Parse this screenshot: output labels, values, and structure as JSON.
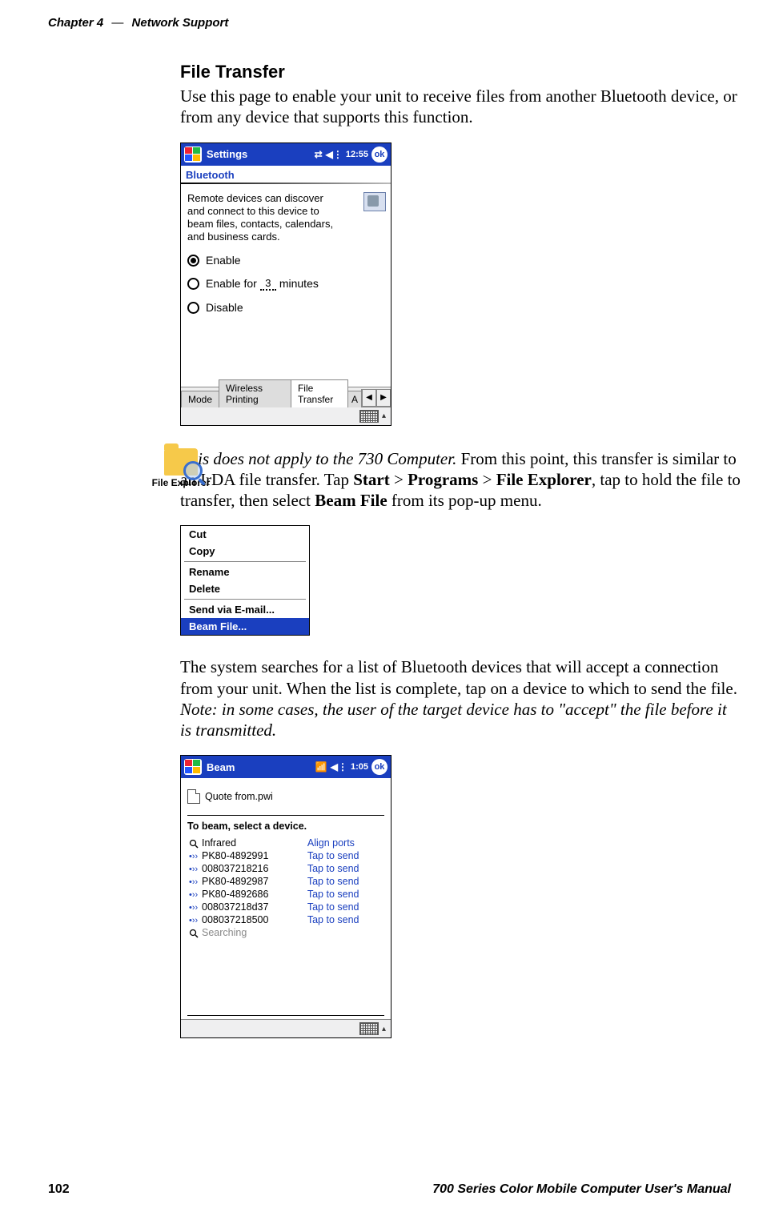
{
  "header": {
    "chapter": "Chapter 4",
    "dash": "—",
    "section": "Network Support"
  },
  "h2": "File Transfer",
  "p1": "Use this page to enable your unit to receive files from another Bluetooth device, or from any device that supports this function.",
  "settings": {
    "title": "Settings",
    "time": "12:55",
    "ok": "ok",
    "heading": "Bluetooth",
    "desc": "Remote devices can discover and connect to this device to beam files, contacts, calendars, and business cards.",
    "opt_enable": "Enable",
    "opt_enable_for_pre": "Enable for",
    "opt_enable_for_value": "3",
    "opt_enable_for_post": "minutes",
    "opt_disable": "Disable",
    "tabs": {
      "mode": "Mode",
      "wp": "Wireless Printing",
      "ft": "File Transfer",
      "extra": "A"
    }
  },
  "fe_label": "File Explorer",
  "p2_italic": "This does not apply to the 730 Computer.",
  "p2_a": " From this point, this transfer is similar to an IrDA file transfer. Tap ",
  "p2_start": "Start",
  "p2_gt1": " > ",
  "p2_programs": "Programs",
  "p2_gt2": " > ",
  "p2_fe": "File Explorer",
  "p2_b": ", tap to hold the file to transfer, then select ",
  "p2_beam": "Beam File",
  "p2_c": " from its pop-up menu.",
  "ctx": {
    "cut": "Cut",
    "copy": "Copy",
    "rename": "Rename",
    "delete": "Delete",
    "email": "Send via E-mail...",
    "beam": "Beam File..."
  },
  "p3_a": "The system searches for a list of Bluetooth devices that will accept a connection from your unit. When the list is complete, tap on a device to which to send the file. ",
  "p3_note": "Note: in some cases, the user of the target device has to \"accept\" the file before it is transmitted.",
  "beam": {
    "title": "Beam",
    "time": "1:05",
    "ok": "ok",
    "file": "Quote from.pwi",
    "instr": "To beam, select a device.",
    "rows": [
      {
        "icon": "ir",
        "name": "Infrared",
        "action": "Align ports"
      },
      {
        "icon": "bt",
        "name": "PK80-4892991",
        "action": "Tap to send"
      },
      {
        "icon": "bt",
        "name": "008037218216",
        "action": "Tap to send"
      },
      {
        "icon": "bt",
        "name": "PK80-4892987",
        "action": "Tap to send"
      },
      {
        "icon": "bt",
        "name": "PK80-4892686",
        "action": "Tap to send"
      },
      {
        "icon": "bt",
        "name": "008037218d37",
        "action": "Tap to send"
      },
      {
        "icon": "bt",
        "name": "008037218500",
        "action": "Tap to send"
      },
      {
        "icon": "search",
        "name": "Searching",
        "action": ""
      }
    ]
  },
  "footer": {
    "page": "102",
    "title": "700 Series Color Mobile Computer User's Manual"
  }
}
